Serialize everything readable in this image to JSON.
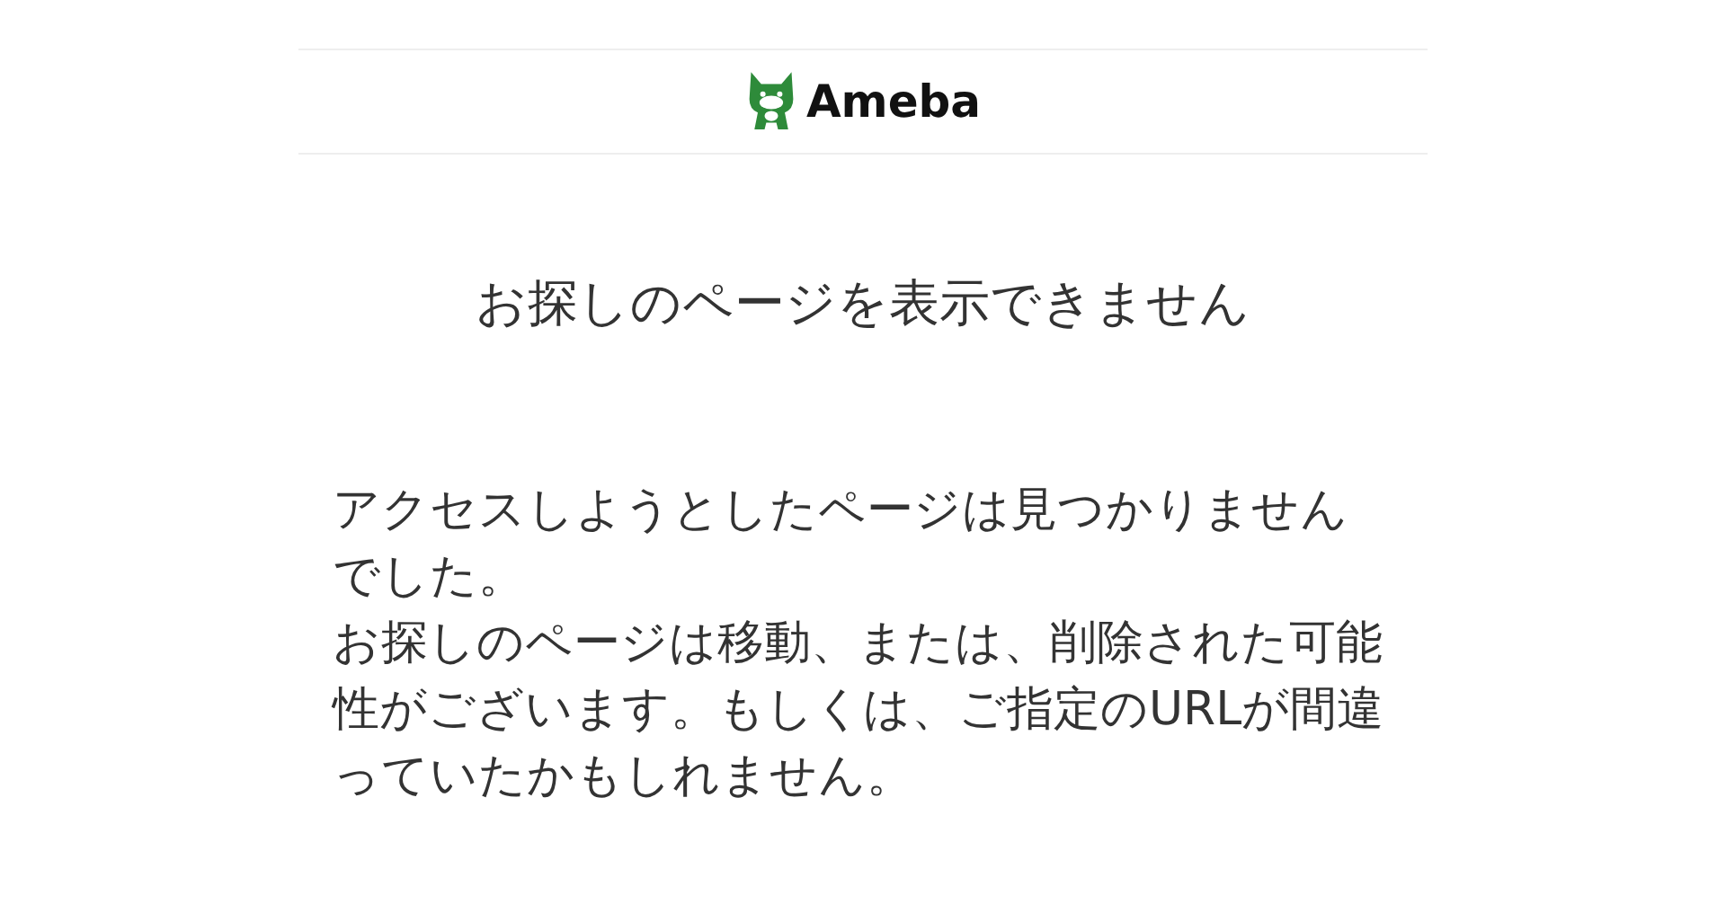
{
  "header": {
    "logo_text": "Ameba"
  },
  "title": "お探しのページを表示できません",
  "paragraphs": [
    "アクセスしようとしたページは見つかりませんでした。",
    "お探しのページは移動、または、削除された可能性がございます。もしくは、ご指定のURLが間違っていたかもしれません。"
  ]
}
